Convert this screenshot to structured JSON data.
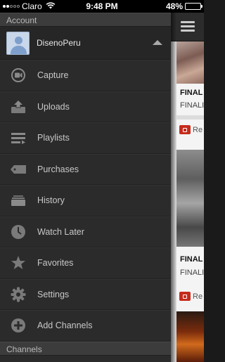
{
  "status_bar": {
    "carrier": "Claro",
    "time": "9:48 PM",
    "battery_text": "48%",
    "battery_level": 0.48
  },
  "menu": {
    "account_header": "Account",
    "account_name": "DisenoPeru",
    "items": [
      {
        "label": "Capture",
        "icon": "capture-icon"
      },
      {
        "label": "Uploads",
        "icon": "upload-icon"
      },
      {
        "label": "Playlists",
        "icon": "playlist-icon"
      },
      {
        "label": "Purchases",
        "icon": "tag-icon"
      },
      {
        "label": "History",
        "icon": "history-icon"
      },
      {
        "label": "Watch Later",
        "icon": "clock-icon"
      },
      {
        "label": "Favorites",
        "icon": "star-icon"
      },
      {
        "label": "Settings",
        "icon": "gear-icon"
      },
      {
        "label": "Add Channels",
        "icon": "plus-circle-icon"
      }
    ],
    "channels_header": "Channels"
  },
  "content": {
    "cards": [
      {
        "title": "FINAL",
        "subtitle": "FINALI"
      },
      {
        "badge_text": "Re",
        "title": "FINAL",
        "subtitle": "FINALI"
      },
      {
        "badge_text": "Re"
      }
    ]
  }
}
